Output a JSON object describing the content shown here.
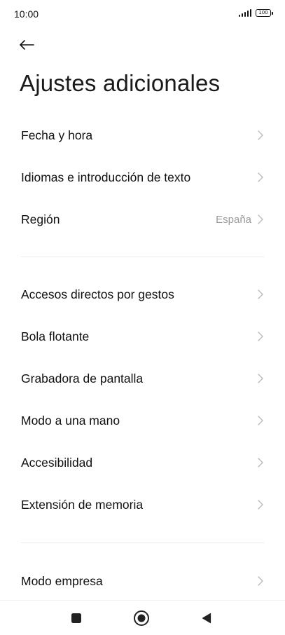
{
  "status_bar": {
    "time": "10:00",
    "battery": "100"
  },
  "header": {
    "title": "Ajustes adicionales"
  },
  "sections": [
    {
      "items": [
        {
          "label": "Fecha y hora",
          "value": ""
        },
        {
          "label": "Idiomas e introducción de texto",
          "value": ""
        },
        {
          "label": "Región",
          "value": "España"
        }
      ]
    },
    {
      "items": [
        {
          "label": "Accesos directos por gestos",
          "value": ""
        },
        {
          "label": "Bola flotante",
          "value": ""
        },
        {
          "label": "Grabadora de pantalla",
          "value": ""
        },
        {
          "label": "Modo a una mano",
          "value": ""
        },
        {
          "label": "Accesibilidad",
          "value": ""
        },
        {
          "label": "Extensión de memoria",
          "value": ""
        }
      ]
    },
    {
      "items": [
        {
          "label": "Modo empresa",
          "value": ""
        }
      ]
    }
  ],
  "icons": {
    "back": "arrow-left-icon",
    "chevron": "chevron-right-icon",
    "nav_recents": "square-icon",
    "nav_home": "circle-icon",
    "nav_back": "triangle-left-icon"
  },
  "colors": {
    "text": "#111111",
    "secondary": "#9a9a9a",
    "divider": "#ececec"
  }
}
